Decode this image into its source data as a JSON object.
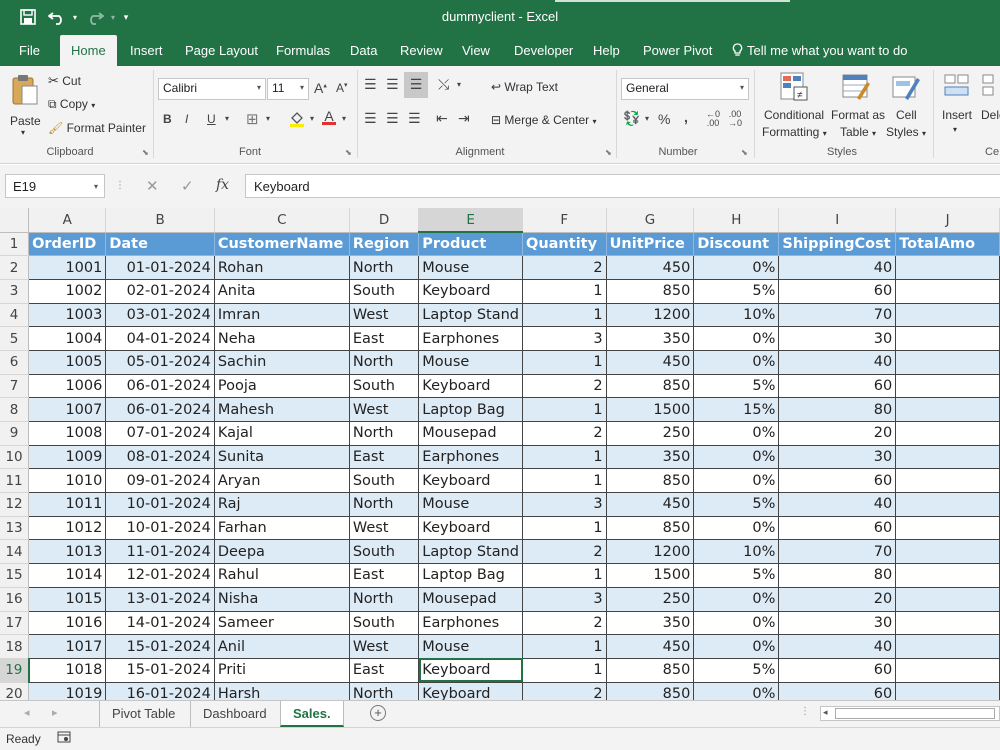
{
  "titlebar": {
    "title": "dummyclient  -  Excel",
    "save_icon": "save-icon",
    "undo_icon": "undo-icon",
    "redo_icon": "redo-icon",
    "customize_icon": "customize-quick-access-icon"
  },
  "menu": {
    "tabs": [
      "File",
      "Home",
      "Insert",
      "Page Layout",
      "Formulas",
      "Data",
      "Review",
      "View",
      "Developer",
      "Help",
      "Power Pivot"
    ],
    "active": "Home",
    "tell_me": "Tell me what you want to do"
  },
  "ribbon": {
    "clipboard": {
      "paste": "Paste",
      "cut": "Cut",
      "copy": "Copy",
      "format_painter": "Format Painter",
      "label": "Clipboard"
    },
    "font": {
      "name": "Calibri",
      "size": "11",
      "bold": "B",
      "italic": "I",
      "underline": "U",
      "label": "Font"
    },
    "alignment": {
      "wrap_text": "Wrap Text",
      "merge_center": "Merge & Center",
      "label": "Alignment"
    },
    "number": {
      "format": "General",
      "percent": "%",
      "comma": ",",
      "label": "Number"
    },
    "styles": {
      "conditional": "Conditional",
      "formatting": "Formatting",
      "format_as": "Format as",
      "table": "Table",
      "cell": "Cell",
      "cell_styles": "Styles",
      "label": "Styles"
    },
    "cells": {
      "insert": "Insert",
      "delete": "Dele",
      "label": "Ce"
    }
  },
  "formula_bar": {
    "name_box": "E19",
    "cancel": "✕",
    "enter": "✓",
    "fx": "fx",
    "content": "Keyboard"
  },
  "grid": {
    "columns": [
      "A",
      "B",
      "C",
      "D",
      "E",
      "F",
      "G",
      "H",
      "I",
      "J"
    ],
    "selected_column": "E",
    "selected_row": 19,
    "headers": [
      "OrderID",
      "Date",
      "CustomerName",
      "Region",
      "Product",
      "Quantity",
      "UnitPrice",
      "Discount",
      "ShippingCost",
      "TotalAmo"
    ],
    "rows": [
      [
        "1001",
        "01-01-2024",
        "Rohan",
        "North",
        "Mouse",
        "2",
        "450",
        "0%",
        "40"
      ],
      [
        "1002",
        "02-01-2024",
        "Anita",
        "South",
        "Keyboard",
        "1",
        "850",
        "5%",
        "60"
      ],
      [
        "1003",
        "03-01-2024",
        "Imran",
        "West",
        "Laptop Stand",
        "1",
        "1200",
        "10%",
        "70"
      ],
      [
        "1004",
        "04-01-2024",
        "Neha",
        "East",
        "Earphones",
        "3",
        "350",
        "0%",
        "30"
      ],
      [
        "1005",
        "05-01-2024",
        "Sachin",
        "North",
        "Mouse",
        "1",
        "450",
        "0%",
        "40"
      ],
      [
        "1006",
        "06-01-2024",
        "Pooja",
        "South",
        "Keyboard",
        "2",
        "850",
        "5%",
        "60"
      ],
      [
        "1007",
        "06-01-2024",
        "Mahesh",
        "West",
        "Laptop Bag",
        "1",
        "1500",
        "15%",
        "80"
      ],
      [
        "1008",
        "07-01-2024",
        "Kajal",
        "North",
        "Mousepad",
        "2",
        "250",
        "0%",
        "20"
      ],
      [
        "1009",
        "08-01-2024",
        "Sunita",
        "East",
        "Earphones",
        "1",
        "350",
        "0%",
        "30"
      ],
      [
        "1010",
        "09-01-2024",
        "Aryan",
        "South",
        "Keyboard",
        "1",
        "850",
        "0%",
        "60"
      ],
      [
        "1011",
        "10-01-2024",
        "Raj",
        "North",
        "Mouse",
        "3",
        "450",
        "5%",
        "40"
      ],
      [
        "1012",
        "10-01-2024",
        "Farhan",
        "West",
        "Keyboard",
        "1",
        "850",
        "0%",
        "60"
      ],
      [
        "1013",
        "11-01-2024",
        "Deepa",
        "South",
        "Laptop Stand",
        "2",
        "1200",
        "10%",
        "70"
      ],
      [
        "1014",
        "12-01-2024",
        "Rahul",
        "East",
        "Laptop Bag",
        "1",
        "1500",
        "5%",
        "80"
      ],
      [
        "1015",
        "13-01-2024",
        "Nisha",
        "North",
        "Mousepad",
        "3",
        "250",
        "0%",
        "20"
      ],
      [
        "1016",
        "14-01-2024",
        "Sameer",
        "South",
        "Earphones",
        "2",
        "350",
        "0%",
        "30"
      ],
      [
        "1017",
        "15-01-2024",
        "Anil",
        "West",
        "Mouse",
        "1",
        "450",
        "0%",
        "40"
      ],
      [
        "1018",
        "15-01-2024",
        "Priti",
        "East",
        "Keyboard",
        "1",
        "850",
        "5%",
        "60"
      ],
      [
        "1019",
        "16-01-2024",
        "Harsh",
        "North",
        "Keyboard",
        "2",
        "850",
        "0%",
        "60"
      ]
    ]
  },
  "sheets": {
    "tabs": [
      "Pivot Table",
      "Dashboard",
      "Sales."
    ],
    "active": "Sales.",
    "add_icon": "add-sheet-icon"
  },
  "status": {
    "text": "Ready"
  },
  "colors": {
    "excel_green": "#217346",
    "header_blue": "#5b9bd5",
    "band_blue": "#ddebf7"
  }
}
